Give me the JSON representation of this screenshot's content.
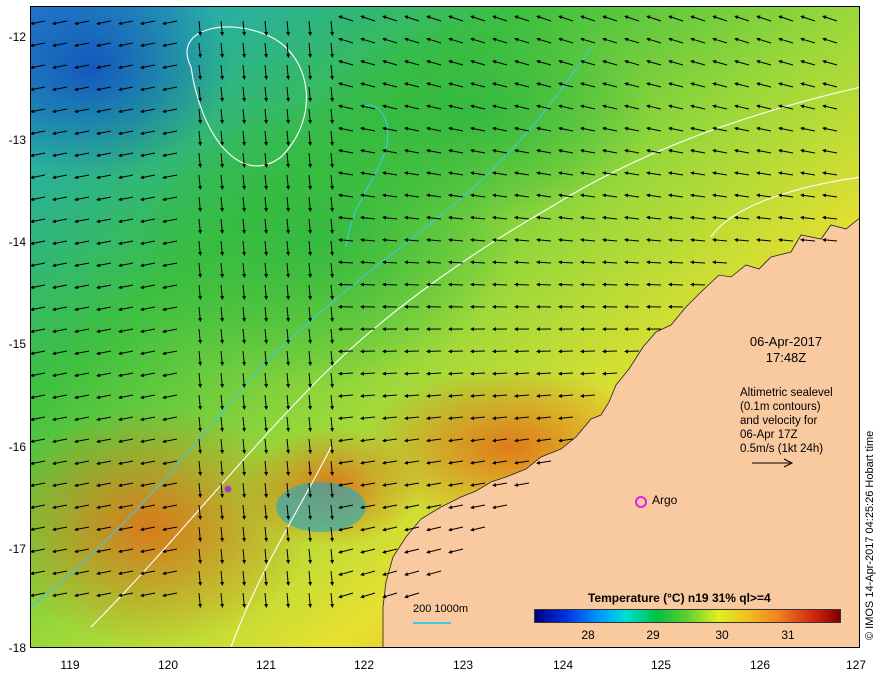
{
  "map": {
    "y_ticks": [
      "-12",
      "-13",
      "-14",
      "-15",
      "-16",
      "-17",
      "-18"
    ],
    "x_ticks": [
      "119",
      "120",
      "121",
      "122",
      "123",
      "124",
      "125",
      "126",
      "127"
    ],
    "timestamp_date": "06-Apr-2017",
    "timestamp_time": "17:48Z",
    "altimetry_note": [
      "Altimetric sealevel",
      "(0.1m contours)",
      "and velocity for",
      "06-Apr 17Z",
      "0.5m/s (1kt 24h)"
    ],
    "argo_label": "Argo",
    "depth_legend": "200  1000m",
    "credit": "© IMOS 14-Apr-2017 04:25:26 Hobart time",
    "colors": {
      "land": "#f9c9a0",
      "argo": "#e020e0",
      "contour": "#40c8e0"
    }
  },
  "legend": {
    "title": "Temperature (°C) n19 31% ql>=4",
    "labels": [
      "28",
      "29",
      "30",
      "31"
    ]
  }
}
